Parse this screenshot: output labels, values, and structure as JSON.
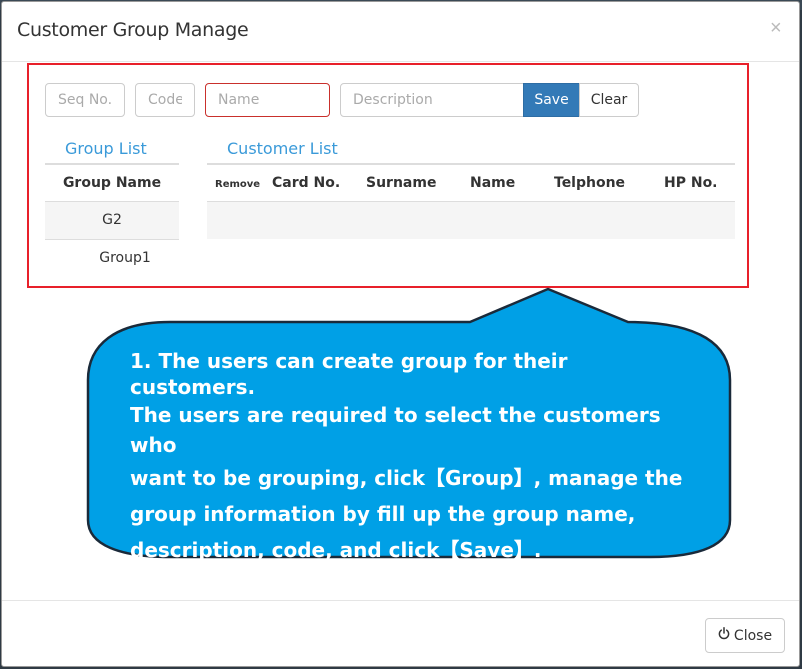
{
  "modal": {
    "title": "Customer Group Manage",
    "close_glyph": "×"
  },
  "form": {
    "seq_placeholder": "Seq No.",
    "code_placeholder": "Code",
    "name_placeholder": "Name",
    "description_placeholder": "Description",
    "save_label": "Save",
    "clear_label": "Clear"
  },
  "group_list": {
    "title": "Group List",
    "header": "Group Name",
    "rows": [
      "G2",
      "Group1"
    ]
  },
  "customer_list": {
    "title": "Customer List",
    "headers": {
      "remove": "Remove",
      "card_no": "Card No.",
      "surname": "Surname",
      "name": "Name",
      "telephone": "Telphone",
      "hp_no": "HP No."
    }
  },
  "callout": {
    "lines": [
      "1. The users can create group for their customers.",
      "The users are required to select the customers who",
      "want to be grouping, click【Group】, manage the",
      "group information by fill up the group name,",
      "description, code, and click【Save】."
    ]
  },
  "footer": {
    "close_label": "Close",
    "power_icon": "power-icon"
  },
  "colors": {
    "accent": "#337ab7",
    "link": "#3a9ad9",
    "highlight_border": "#e8202a",
    "callout_fill": "#00a0e6",
    "callout_stroke": "#1a2a3a"
  }
}
